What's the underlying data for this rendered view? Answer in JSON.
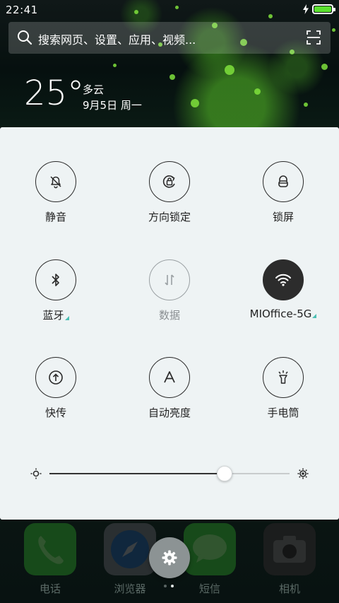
{
  "status_bar": {
    "time": "22:41",
    "battery_level": 1.0,
    "charging": true
  },
  "search": {
    "placeholder": "搜索网页、设置、应用、视频..."
  },
  "weather": {
    "temperature": "25°",
    "condition": "多云",
    "date": "9月5日 周一"
  },
  "toggles": [
    {
      "label": "静音",
      "icon": "bell-off-icon",
      "state": "off"
    },
    {
      "label": "方向锁定",
      "icon": "rotation-lock-icon",
      "state": "off"
    },
    {
      "label": "锁屏",
      "icon": "lock-icon",
      "state": "off"
    },
    {
      "label": "蓝牙",
      "icon": "bluetooth-icon",
      "state": "off",
      "has_more": true
    },
    {
      "label": "数据",
      "icon": "mobile-data-icon",
      "state": "disabled"
    },
    {
      "label": "MIOffice-5G",
      "icon": "wifi-icon",
      "state": "on",
      "has_more": true
    },
    {
      "label": "快传",
      "icon": "quick-transfer-icon",
      "state": "off"
    },
    {
      "label": "自动亮度",
      "icon": "auto-brightness-icon",
      "state": "off"
    },
    {
      "label": "手电筒",
      "icon": "flashlight-icon",
      "state": "off"
    }
  ],
  "brightness": {
    "level": 0.73
  },
  "dock": [
    {
      "label": "电话",
      "icon": "phone-icon"
    },
    {
      "label": "浏览器",
      "icon": "browser-icon"
    },
    {
      "label": "短信",
      "icon": "messages-icon"
    },
    {
      "label": "相机",
      "icon": "camera-icon"
    }
  ],
  "pager": {
    "pages": 2,
    "current": 2
  },
  "colors": {
    "panel_bg": "#eef3f4",
    "active_toggle": "#2c2c2c",
    "accent_corner": "#4bbfb3",
    "battery_fill": "#5be12f"
  }
}
